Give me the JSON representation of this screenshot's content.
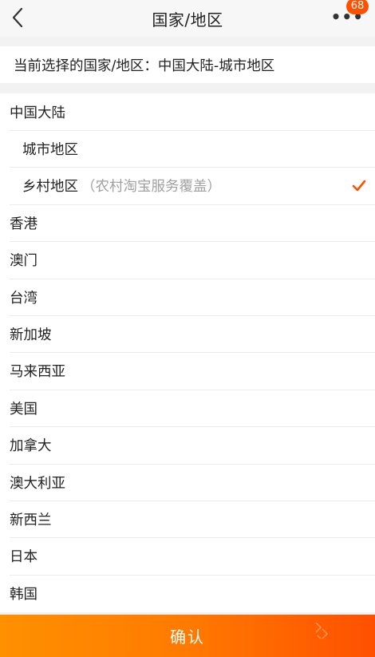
{
  "navbar": {
    "title": "国家/地区",
    "badge_count": "68",
    "more_icon": "more-dots-icon",
    "back_icon": "chevron-left-icon"
  },
  "current": {
    "text": "当前选择的国家/地区：中国大陆-城市地区"
  },
  "list": {
    "items": [
      {
        "label": "中国大陆",
        "sublabel": "",
        "indented": false,
        "checked": false
      },
      {
        "label": "城市地区",
        "sublabel": "",
        "indented": true,
        "checked": false
      },
      {
        "label": "乡村地区",
        "sublabel": "（农村淘宝服务覆盖）",
        "indented": true,
        "checked": true
      },
      {
        "label": "香港",
        "sublabel": "",
        "indented": false,
        "checked": false
      },
      {
        "label": "澳门",
        "sublabel": "",
        "indented": false,
        "checked": false
      },
      {
        "label": "台湾",
        "sublabel": "",
        "indented": false,
        "checked": false
      },
      {
        "label": "新加坡",
        "sublabel": "",
        "indented": false,
        "checked": false
      },
      {
        "label": "马来西亚",
        "sublabel": "",
        "indented": false,
        "checked": false
      },
      {
        "label": "美国",
        "sublabel": "",
        "indented": false,
        "checked": false
      },
      {
        "label": "加拿大",
        "sublabel": "",
        "indented": false,
        "checked": false
      },
      {
        "label": "澳大利亚",
        "sublabel": "",
        "indented": false,
        "checked": false
      },
      {
        "label": "新西兰",
        "sublabel": "",
        "indented": false,
        "checked": false
      },
      {
        "label": "日本",
        "sublabel": "",
        "indented": false,
        "checked": false
      },
      {
        "label": "韩国",
        "sublabel": "",
        "indented": false,
        "checked": false
      }
    ]
  },
  "confirm": {
    "label": "确认"
  },
  "colors": {
    "accent": "#ff5000",
    "check": "#ff5000",
    "confirm_start": "#ff9000",
    "confirm_end": "#ff5000",
    "muted_text": "#a0a0a0"
  }
}
